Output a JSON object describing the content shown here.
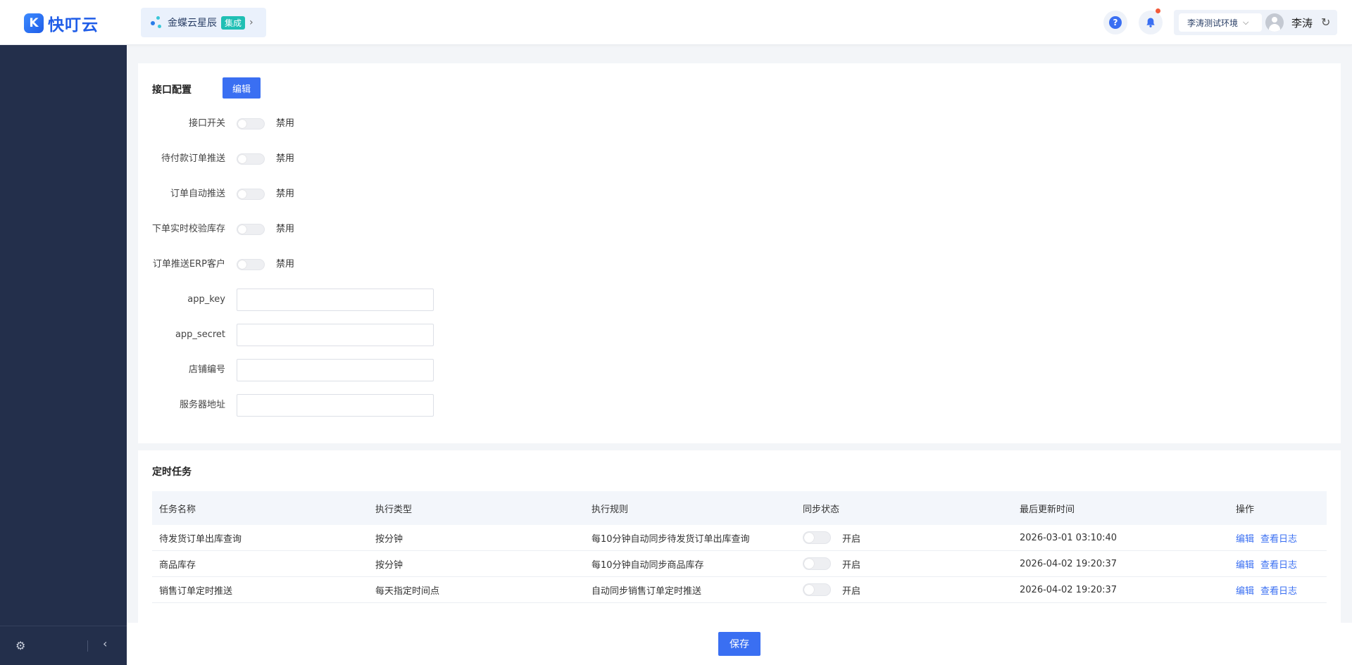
{
  "header": {
    "logo_mark": "K",
    "logo_text": "快叮云",
    "app_name": "金蝶云星辰",
    "app_badge": "集成",
    "app_chevron": "›",
    "help_symbol": "?",
    "env_select": "李涛测试环境",
    "user_name": "李涛",
    "refresh_symbol": "↻"
  },
  "sidebar": {
    "settings_symbol": "⚙",
    "collapse_symbol": "‹"
  },
  "config": {
    "title": "接口配置",
    "edit_label": "编辑",
    "toggles": [
      {
        "label": "接口开关",
        "state": "禁用"
      },
      {
        "label": "待付款订单推送",
        "state": "禁用"
      },
      {
        "label": "订单自动推送",
        "state": "禁用"
      },
      {
        "label": "下单实时校验库存",
        "state": "禁用"
      },
      {
        "label": "订单推送ERP客户",
        "state": "禁用"
      }
    ],
    "fields": [
      {
        "label": "app_key",
        "value": ""
      },
      {
        "label": "app_secret",
        "value": ""
      },
      {
        "label": "店铺编号",
        "value": ""
      },
      {
        "label": "服务器地址",
        "value": ""
      }
    ]
  },
  "tasks": {
    "title": "定时任务",
    "columns": [
      "任务名称",
      "执行类型",
      "执行规则",
      "同步状态",
      "最后更新时间",
      "操作"
    ],
    "rows": [
      {
        "name": "待发货订单出库查询",
        "type": "按分钟",
        "rule": "每10分钟自动同步待发货订单出库查询",
        "status": "开启",
        "updated": "2026-03-01 03:10:40",
        "edit": "编辑",
        "log": "查看日志"
      },
      {
        "name": "商品库存",
        "type": "按分钟",
        "rule": "每10分钟自动同步商品库存",
        "status": "开启",
        "updated": "2026-04-02 19:20:37",
        "edit": "编辑",
        "log": "查看日志"
      },
      {
        "name": "销售订单定时推送",
        "type": "每天指定时间点",
        "rule": "自动同步销售订单定时推送",
        "status": "开启",
        "updated": "2026-04-02 19:20:37",
        "edit": "编辑",
        "log": "查看日志"
      }
    ]
  },
  "footer": {
    "save_label": "保存"
  }
}
